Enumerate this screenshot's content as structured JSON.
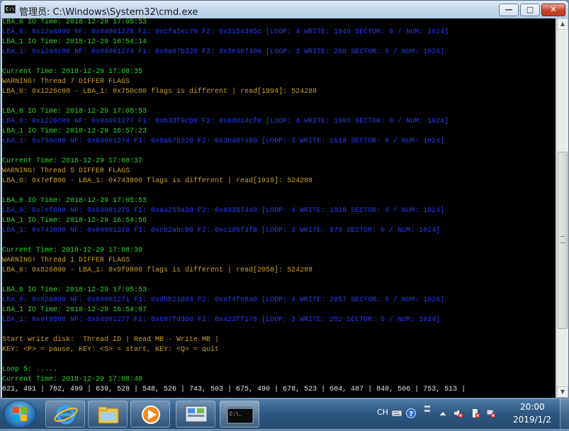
{
  "window": {
    "title": "管理员: C:\\Windows\\System32\\cmd.exe",
    "app_icon_text": "C:\\",
    "min_glyph": "—",
    "max_glyph": "□",
    "close_glyph": "✕"
  },
  "console_lines": [
    {
      "text": "LBA_0 IO Time: 2018-12-29 17:05:53",
      "color": "green"
    },
    {
      "text": "LBA_0: 0x12a4800 NF: 0x04001278 F1: 0xcfa5ec70 F2: 0x3154395c [LOOP: 4 WRITE: 1949 SECTOR: 0 / NUM: 1024]",
      "color": "blue"
    },
    {
      "text": "LBA_1 IO Time: 2018-12-29 16:54:14",
      "color": "green"
    },
    {
      "text": "LBA_1: 0x12a4c00 NF: 0x04001274 F1: 0x0a07b320 F2: 0x3e487400 [LOOP: 3 WRITE: 260 SECTOR: 0 / NUM: 1024]",
      "color": "blue"
    },
    {
      "text": "",
      "color": "white"
    },
    {
      "text": "Current Time: 2018-12-29 17:08:35",
      "color": "green"
    },
    {
      "text": "WARNING! Thread 7 DIFFER FLAGS",
      "color": "yellow"
    },
    {
      "text": "LBA_0: 0x1226c00 - LBA_1: 0x750c00 flags is different | read[1994]: 524288",
      "color": "yellow"
    },
    {
      "text": "",
      "color": "white"
    },
    {
      "text": "LBA_0 IO Time: 2018-12-29 17:05:53",
      "color": "green"
    },
    {
      "text": "LBA_0: 0x1226c00 NF: 0x04001277 F1: 0xb33f0cb0 F2: 0x6d014cf0 [LOOP: 4 WRITE: 1993 SECTOR: 0 / NUM: 1024]",
      "color": "blue"
    },
    {
      "text": "LBA_1 IO Time: 2018-12-29 16:57:23",
      "color": "green"
    },
    {
      "text": "LBA_1: 0x750c00 NF: 0x04001274 F1: 0x0a07b320 F2: 0x3e487400 [LOOP: 3 WRITE: 1614 SECTOR: 0 / NUM: 1024]",
      "color": "blue"
    },
    {
      "text": "",
      "color": "white"
    },
    {
      "text": "Current Time: 2018-12-29 17:08:37",
      "color": "green"
    },
    {
      "text": "WARNING! Thread 5 DIFFER FLAGS",
      "color": "yellow"
    },
    {
      "text": "LBA_0: 0x7ef800 - LBA_1: 0x743800 flags is different | read[1919]: 524288",
      "color": "yellow"
    },
    {
      "text": "",
      "color": "white"
    },
    {
      "text": "LBA_0 IO Time: 2018-12-29 17:05:53",
      "color": "green"
    },
    {
      "text": "LBA_0: 0x7ef800 NF: 0x04001275 F1: 0xa4255a38 F2: 0x03357440 [LOOP: 4 WRITE: 1918 SECTOR: 0 / NUM: 1024]",
      "color": "blue"
    },
    {
      "text": "LBA_1 IO Time: 2018-12-29 16:54:56",
      "color": "green"
    },
    {
      "text": "LBA_1: 0x743800 NF: 0x04001278 F1: 0xcb2abcb0 F2: 0xc1d6f3f8 [LOOP: 3 WRITE: 579 SECTOR: 0 / NUM: 1024]",
      "color": "blue"
    },
    {
      "text": "",
      "color": "white"
    },
    {
      "text": "Current Time: 2018-12-29 17:08:39",
      "color": "green"
    },
    {
      "text": "WARNING! Thread 1 DIFFER FLAGS",
      "color": "yellow"
    },
    {
      "text": "LBA_0: 0x826800 - LBA_1: 0x9f9800 flags is different | read[2058]: 524288",
      "color": "yellow"
    },
    {
      "text": "",
      "color": "white"
    },
    {
      "text": "LBA_0 IO Time: 2018-12-29 17:05:53",
      "color": "green"
    },
    {
      "text": "LBA_0: 0x826800 NF: 0x04001271 F1: 0xdbb21d94 F2: 0xaf4fe8a0 [LOOP: 4 WRITE: 2057 SECTOR: 0 / NUM: 1024]",
      "color": "blue"
    },
    {
      "text": "LBA_1 IO Time: 2018-12-29 16:54:07",
      "color": "green"
    },
    {
      "text": "LBA_1: 0x9f9800 NF: 0x04001277 F1: 0x697fd300 F2: 0x423ff178 [LOOP: 3 WRITE: 202 SECTOR: 0 / NUM: 1024]",
      "color": "blue"
    },
    {
      "text": "",
      "color": "white"
    },
    {
      "text": "Start write disk:  Thread ID | Read MB - Write MB |",
      "color": "yellow"
    },
    {
      "text": "KEY: <P> = pause, KEY: <S> = start, KEY: <Q> = quit",
      "color": "yellow"
    },
    {
      "text": "",
      "color": "white"
    },
    {
      "text": "Loop 5: .....",
      "color": "green"
    },
    {
      "text": "Current Time: 2018-12-29 17:08:40",
      "color": "green"
    },
    {
      "text": "621, 491 | 762, 499 | 639, 528 | 548, 526 | 743, 503 | 675, 490 | 678, 523 | 604, 487 | 840, 506 | 753, 513 |",
      "color": "white"
    }
  ],
  "colors": {
    "green": "#2fd42f",
    "blue": "#2a3cf2",
    "yellow": "#c9a02a",
    "white": "#e6e6e6"
  },
  "taskbar": {
    "items": [
      {
        "name": "internet-explorer",
        "icon": "ie-icon"
      },
      {
        "name": "windows-explorer",
        "icon": "folder-icon"
      },
      {
        "name": "media-player",
        "icon": "media-player-icon"
      },
      {
        "name": "control-panel",
        "icon": "control-panel-icon"
      },
      {
        "name": "cmd",
        "icon": "cmd-icon",
        "active": true
      }
    ],
    "tray": {
      "language": "CH",
      "time": "20:00",
      "date": "2019/1/2"
    }
  }
}
